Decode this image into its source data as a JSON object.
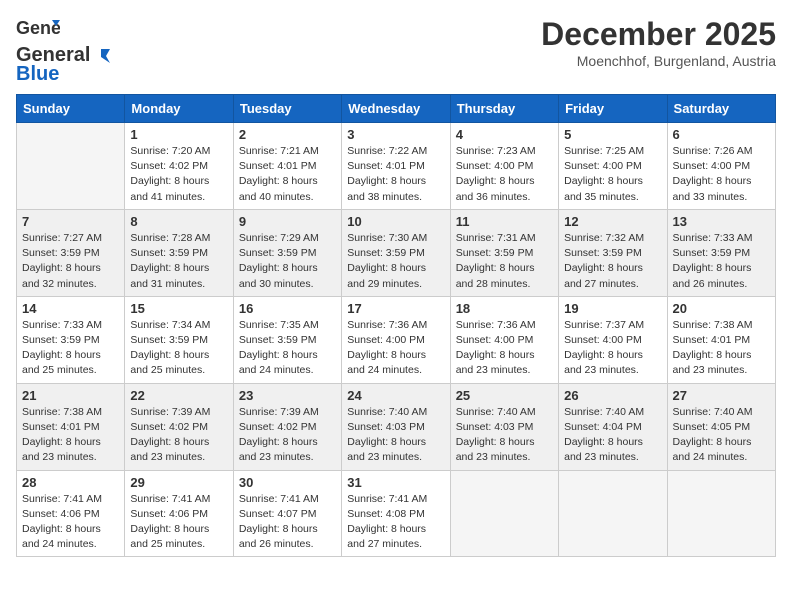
{
  "header": {
    "logo_line1": "General",
    "logo_line2": "Blue",
    "month": "December 2025",
    "location": "Moenchhof, Burgenland, Austria"
  },
  "weekdays": [
    "Sunday",
    "Monday",
    "Tuesday",
    "Wednesday",
    "Thursday",
    "Friday",
    "Saturday"
  ],
  "weeks": [
    [
      {
        "day": "",
        "sunrise": "",
        "sunset": "",
        "daylight": ""
      },
      {
        "day": "1",
        "sunrise": "Sunrise: 7:20 AM",
        "sunset": "Sunset: 4:02 PM",
        "daylight": "Daylight: 8 hours and 41 minutes."
      },
      {
        "day": "2",
        "sunrise": "Sunrise: 7:21 AM",
        "sunset": "Sunset: 4:01 PM",
        "daylight": "Daylight: 8 hours and 40 minutes."
      },
      {
        "day": "3",
        "sunrise": "Sunrise: 7:22 AM",
        "sunset": "Sunset: 4:01 PM",
        "daylight": "Daylight: 8 hours and 38 minutes."
      },
      {
        "day": "4",
        "sunrise": "Sunrise: 7:23 AM",
        "sunset": "Sunset: 4:00 PM",
        "daylight": "Daylight: 8 hours and 36 minutes."
      },
      {
        "day": "5",
        "sunrise": "Sunrise: 7:25 AM",
        "sunset": "Sunset: 4:00 PM",
        "daylight": "Daylight: 8 hours and 35 minutes."
      },
      {
        "day": "6",
        "sunrise": "Sunrise: 7:26 AM",
        "sunset": "Sunset: 4:00 PM",
        "daylight": "Daylight: 8 hours and 33 minutes."
      }
    ],
    [
      {
        "day": "7",
        "sunrise": "Sunrise: 7:27 AM",
        "sunset": "Sunset: 3:59 PM",
        "daylight": "Daylight: 8 hours and 32 minutes."
      },
      {
        "day": "8",
        "sunrise": "Sunrise: 7:28 AM",
        "sunset": "Sunset: 3:59 PM",
        "daylight": "Daylight: 8 hours and 31 minutes."
      },
      {
        "day": "9",
        "sunrise": "Sunrise: 7:29 AM",
        "sunset": "Sunset: 3:59 PM",
        "daylight": "Daylight: 8 hours and 30 minutes."
      },
      {
        "day": "10",
        "sunrise": "Sunrise: 7:30 AM",
        "sunset": "Sunset: 3:59 PM",
        "daylight": "Daylight: 8 hours and 29 minutes."
      },
      {
        "day": "11",
        "sunrise": "Sunrise: 7:31 AM",
        "sunset": "Sunset: 3:59 PM",
        "daylight": "Daylight: 8 hours and 28 minutes."
      },
      {
        "day": "12",
        "sunrise": "Sunrise: 7:32 AM",
        "sunset": "Sunset: 3:59 PM",
        "daylight": "Daylight: 8 hours and 27 minutes."
      },
      {
        "day": "13",
        "sunrise": "Sunrise: 7:33 AM",
        "sunset": "Sunset: 3:59 PM",
        "daylight": "Daylight: 8 hours and 26 minutes."
      }
    ],
    [
      {
        "day": "14",
        "sunrise": "Sunrise: 7:33 AM",
        "sunset": "Sunset: 3:59 PM",
        "daylight": "Daylight: 8 hours and 25 minutes."
      },
      {
        "day": "15",
        "sunrise": "Sunrise: 7:34 AM",
        "sunset": "Sunset: 3:59 PM",
        "daylight": "Daylight: 8 hours and 25 minutes."
      },
      {
        "day": "16",
        "sunrise": "Sunrise: 7:35 AM",
        "sunset": "Sunset: 3:59 PM",
        "daylight": "Daylight: 8 hours and 24 minutes."
      },
      {
        "day": "17",
        "sunrise": "Sunrise: 7:36 AM",
        "sunset": "Sunset: 4:00 PM",
        "daylight": "Daylight: 8 hours and 24 minutes."
      },
      {
        "day": "18",
        "sunrise": "Sunrise: 7:36 AM",
        "sunset": "Sunset: 4:00 PM",
        "daylight": "Daylight: 8 hours and 23 minutes."
      },
      {
        "day": "19",
        "sunrise": "Sunrise: 7:37 AM",
        "sunset": "Sunset: 4:00 PM",
        "daylight": "Daylight: 8 hours and 23 minutes."
      },
      {
        "day": "20",
        "sunrise": "Sunrise: 7:38 AM",
        "sunset": "Sunset: 4:01 PM",
        "daylight": "Daylight: 8 hours and 23 minutes."
      }
    ],
    [
      {
        "day": "21",
        "sunrise": "Sunrise: 7:38 AM",
        "sunset": "Sunset: 4:01 PM",
        "daylight": "Daylight: 8 hours and 23 minutes."
      },
      {
        "day": "22",
        "sunrise": "Sunrise: 7:39 AM",
        "sunset": "Sunset: 4:02 PM",
        "daylight": "Daylight: 8 hours and 23 minutes."
      },
      {
        "day": "23",
        "sunrise": "Sunrise: 7:39 AM",
        "sunset": "Sunset: 4:02 PM",
        "daylight": "Daylight: 8 hours and 23 minutes."
      },
      {
        "day": "24",
        "sunrise": "Sunrise: 7:40 AM",
        "sunset": "Sunset: 4:03 PM",
        "daylight": "Daylight: 8 hours and 23 minutes."
      },
      {
        "day": "25",
        "sunrise": "Sunrise: 7:40 AM",
        "sunset": "Sunset: 4:03 PM",
        "daylight": "Daylight: 8 hours and 23 minutes."
      },
      {
        "day": "26",
        "sunrise": "Sunrise: 7:40 AM",
        "sunset": "Sunset: 4:04 PM",
        "daylight": "Daylight: 8 hours and 23 minutes."
      },
      {
        "day": "27",
        "sunrise": "Sunrise: 7:40 AM",
        "sunset": "Sunset: 4:05 PM",
        "daylight": "Daylight: 8 hours and 24 minutes."
      }
    ],
    [
      {
        "day": "28",
        "sunrise": "Sunrise: 7:41 AM",
        "sunset": "Sunset: 4:06 PM",
        "daylight": "Daylight: 8 hours and 24 minutes."
      },
      {
        "day": "29",
        "sunrise": "Sunrise: 7:41 AM",
        "sunset": "Sunset: 4:06 PM",
        "daylight": "Daylight: 8 hours and 25 minutes."
      },
      {
        "day": "30",
        "sunrise": "Sunrise: 7:41 AM",
        "sunset": "Sunset: 4:07 PM",
        "daylight": "Daylight: 8 hours and 26 minutes."
      },
      {
        "day": "31",
        "sunrise": "Sunrise: 7:41 AM",
        "sunset": "Sunset: 4:08 PM",
        "daylight": "Daylight: 8 hours and 27 minutes."
      },
      {
        "day": "",
        "sunrise": "",
        "sunset": "",
        "daylight": ""
      },
      {
        "day": "",
        "sunrise": "",
        "sunset": "",
        "daylight": ""
      },
      {
        "day": "",
        "sunrise": "",
        "sunset": "",
        "daylight": ""
      }
    ]
  ]
}
